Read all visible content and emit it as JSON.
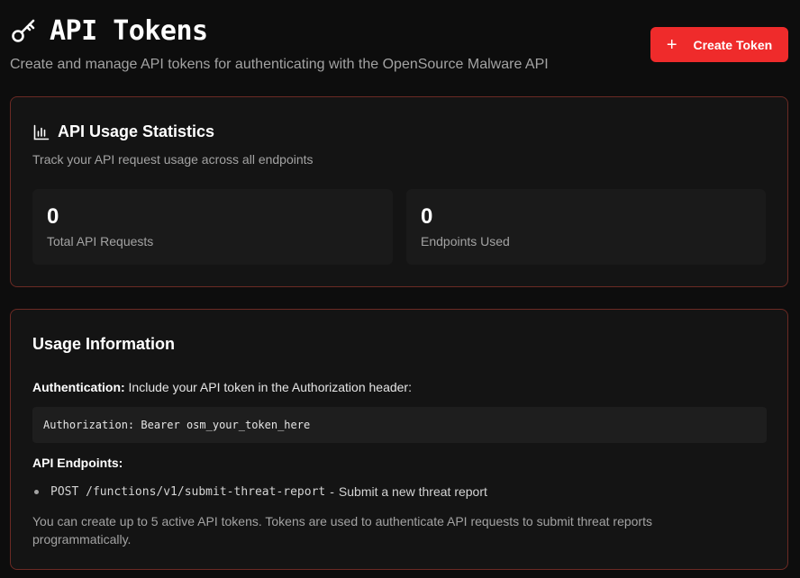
{
  "header": {
    "title": "API Tokens",
    "subtitle": "Create and manage API tokens for authenticating with the OpenSource Malware API",
    "title_icon": "key-icon",
    "create_button": {
      "icon": "plus-icon",
      "label": "Create Token"
    }
  },
  "stats_card": {
    "icon": "bar-chart-icon",
    "title": "API Usage Statistics",
    "description": "Track your API request usage across all endpoints",
    "stats": [
      {
        "value": "0",
        "label": "Total API Requests"
      },
      {
        "value": "0",
        "label": "Endpoints Used"
      }
    ]
  },
  "usage_card": {
    "title": "Usage Information",
    "auth_label": "Authentication:",
    "auth_text": " Include your API token in the Authorization header:",
    "auth_code": "Authorization: Bearer osm_your_token_here",
    "endpoints_heading": "API Endpoints:",
    "endpoints": [
      {
        "method_path": "POST /functions/v1/submit-threat-report",
        "separator": "-",
        "description": "Submit a new threat report"
      }
    ],
    "note": "You can create up to 5 active API tokens. Tokens are used to authenticate API requests to submit threat reports programmatically."
  },
  "colors": {
    "background": "#0d0d0d",
    "card_background": "#141414",
    "card_border": "#6b2a24",
    "accent_button": "#ef2b2b"
  }
}
